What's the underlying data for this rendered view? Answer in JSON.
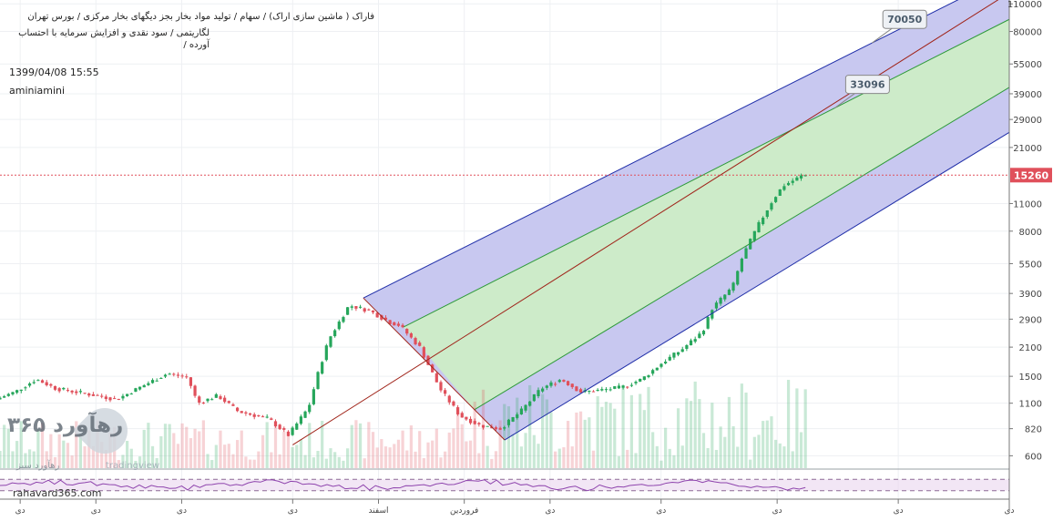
{
  "header": {
    "title_line1": "فاراک ( ماشین سازی اراک) / سهام / تولید مواد بخار بجز دیگهای بخار مرکزی / بورس تهران",
    "title_line2": "لگاریتمی / سود نقدی و افزایش سرمایه با احتساب آورده /",
    "timestamp": "1399/04/08 15:55",
    "author": "aminiamini"
  },
  "watermark": {
    "logo_text": "رهآورد ۳۶۵",
    "logo_subtitle": "رهآورد سبز",
    "tradingview_text": "tradingview",
    "site": "rahavard365.com"
  },
  "colors": {
    "up": "#26a65b",
    "down": "#e0505b",
    "outer_band": "#c8c8f0",
    "inner_band": "#cdebc9",
    "outer_line": "#1f2ea8",
    "inner_line": "#2e9a3a",
    "median_line": "#a0241a",
    "last_price_line": "#e0505b"
  },
  "chart_data": {
    "type": "candlestick",
    "scale": "log",
    "y_ticks": [
      600,
      820,
      1100,
      1500,
      2100,
      2900,
      3900,
      5500,
      8000,
      11000,
      15260,
      21000,
      29000,
      39000,
      55000,
      80000,
      110000
    ],
    "y_tick_labels": [
      "600",
      "820",
      "1100",
      "1500",
      "2100",
      "2900",
      "3900",
      "5500",
      "8000",
      "11000",
      "15260",
      "21000",
      "29000",
      "39000",
      "55000",
      "80000",
      "110000"
    ],
    "ylim": [
      520,
      115000
    ],
    "last_price": 15260,
    "x_ticks": [
      {
        "label": "دی",
        "x": 0.02
      },
      {
        "label": "دی",
        "x": 0.095
      },
      {
        "label": "دی",
        "x": 0.18
      },
      {
        "label": "دی",
        "x": 0.29
      },
      {
        "label": "اسفند",
        "x": 0.375
      },
      {
        "label": "فروردین",
        "x": 0.46
      },
      {
        "label": "دی",
        "x": 0.545
      },
      {
        "label": "دی",
        "x": 0.655
      },
      {
        "label": "دی",
        "x": 0.77
      },
      {
        "label": "دی",
        "x": 0.89
      },
      {
        "label": "دی",
        "x": 1.0
      }
    ],
    "price_path": [
      [
        0.0,
        1150
      ],
      [
        0.02,
        1260
      ],
      [
        0.04,
        1450
      ],
      [
        0.06,
        1300
      ],
      [
        0.08,
        1250
      ],
      [
        0.1,
        1200
      ],
      [
        0.12,
        1150
      ],
      [
        0.14,
        1300
      ],
      [
        0.17,
        1550
      ],
      [
        0.19,
        1480
      ],
      [
        0.2,
        1100
      ],
      [
        0.22,
        1200
      ],
      [
        0.24,
        1000
      ],
      [
        0.27,
        920
      ],
      [
        0.29,
        760
      ],
      [
        0.31,
        1050
      ],
      [
        0.32,
        1600
      ],
      [
        0.33,
        2300
      ],
      [
        0.35,
        3400
      ],
      [
        0.37,
        3200
      ],
      [
        0.39,
        2800
      ],
      [
        0.4,
        2700
      ],
      [
        0.42,
        2100
      ],
      [
        0.44,
        1300
      ],
      [
        0.46,
        950
      ],
      [
        0.48,
        850
      ],
      [
        0.5,
        820
      ],
      [
        0.52,
        1000
      ],
      [
        0.54,
        1300
      ],
      [
        0.56,
        1450
      ],
      [
        0.58,
        1250
      ],
      [
        0.6,
        1280
      ],
      [
        0.62,
        1320
      ],
      [
        0.64,
        1450
      ],
      [
        0.66,
        1750
      ],
      [
        0.68,
        2050
      ],
      [
        0.7,
        2500
      ],
      [
        0.71,
        3300
      ],
      [
        0.73,
        4200
      ],
      [
        0.74,
        6000
      ],
      [
        0.755,
        8500
      ],
      [
        0.77,
        11500
      ],
      [
        0.78,
        13500
      ],
      [
        0.8,
        15260
      ]
    ],
    "pitchfork": [
      {
        "name": "outer-upper",
        "p1": [
          0.36,
          3700
        ],
        "p2": [
          1.0,
          155000
        ],
        "style": "outer"
      },
      {
        "name": "inner-upper",
        "p1": [
          0.4,
          2650
        ],
        "p2": [
          1.0,
          92000
        ],
        "style": "inner"
      },
      {
        "name": "median",
        "p1": [
          0.29,
          680
        ],
        "p2": [
          1.0,
          125000
        ],
        "style": "median"
      },
      {
        "name": "inner-lower",
        "p1": [
          0.47,
          1020
        ],
        "p2": [
          1.0,
          42000
        ],
        "style": "inner"
      },
      {
        "name": "outer-lower",
        "p1": [
          0.5,
          720
        ],
        "p2": [
          1.0,
          25000
        ],
        "style": "outer"
      }
    ],
    "pitchfork_base": {
      "p1": [
        0.36,
        3700
      ],
      "p2": [
        0.5,
        720
      ]
    },
    "annotations": [
      {
        "text": "70050",
        "value": 70050
      },
      {
        "text": "33096",
        "value": 33096
      }
    ],
    "rsi_panel": {
      "upper": 70,
      "lower": 30,
      "range": [
        0,
        100
      ]
    }
  }
}
